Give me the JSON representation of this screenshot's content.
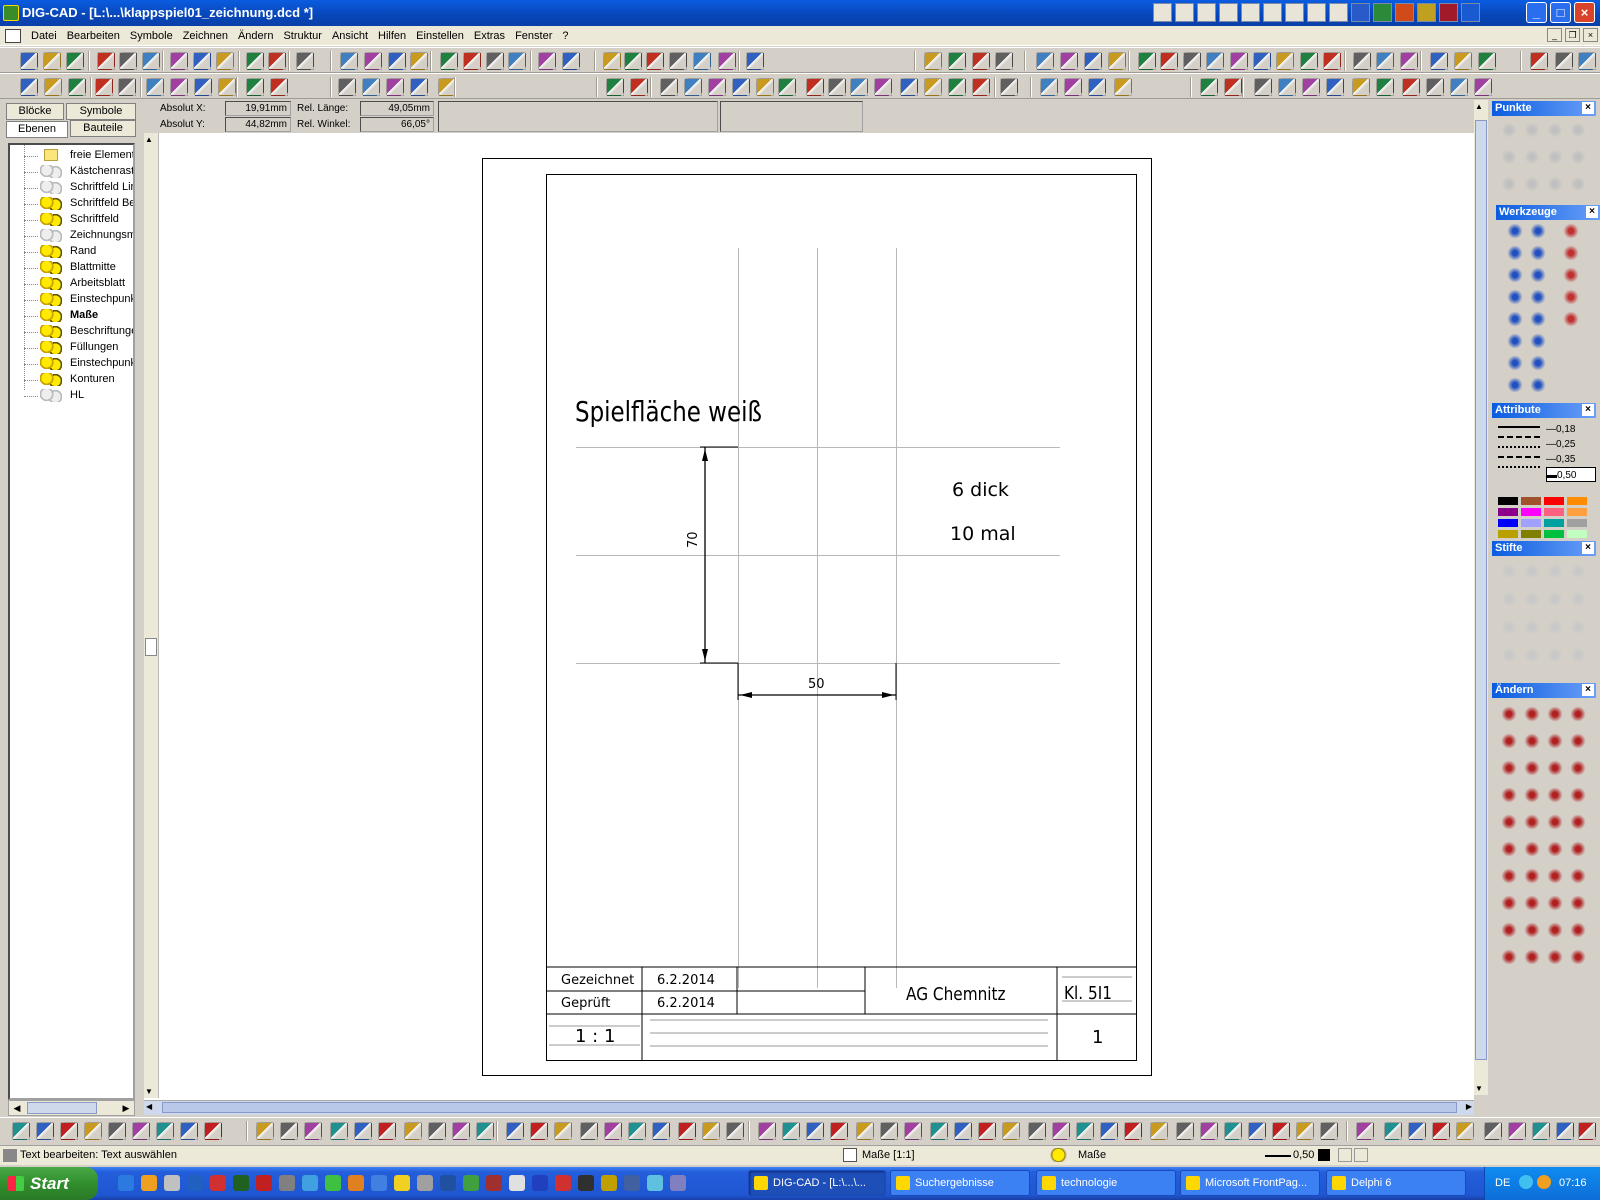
{
  "window": {
    "title": "DIG-CAD - [L:\\...\\klappspiel01_zeichnung.dcd *]",
    "minimize": "_",
    "maximize": "□",
    "close": "×"
  },
  "menu": [
    "Datei",
    "Bearbeiten",
    "Symbole",
    "Zeichnen",
    "Ändern",
    "Struktur",
    "Ansicht",
    "Hilfen",
    "Einstellen",
    "Extras",
    "Fenster",
    "?"
  ],
  "left_panel": {
    "tabs": [
      "Blöcke",
      "Symbole",
      "Ebenen",
      "Bauteile"
    ],
    "active_tab": "Ebenen",
    "layers": [
      {
        "label": "freie Element",
        "icon": "folder-icon",
        "state": "folder",
        "bold": false
      },
      {
        "label": "Kästchenrast",
        "icon": "layer-icon",
        "state": "dim",
        "bold": false
      },
      {
        "label": "Schriftfeld Lir",
        "icon": "layer-icon",
        "state": "dim",
        "bold": false
      },
      {
        "label": "Schriftfeld Be",
        "icon": "layer-icon",
        "state": "lit",
        "bold": false
      },
      {
        "label": "Schriftfeld",
        "icon": "layer-icon",
        "state": "lit",
        "bold": false
      },
      {
        "label": "Zeichnungsmi",
        "icon": "layer-icon",
        "state": "dim",
        "bold": false
      },
      {
        "label": "Rand",
        "icon": "layer-icon",
        "state": "lit",
        "bold": false
      },
      {
        "label": "Blattmitte",
        "icon": "layer-icon",
        "state": "lit",
        "bold": false
      },
      {
        "label": "Arbeitsblatt",
        "icon": "layer-icon",
        "state": "lit",
        "bold": false
      },
      {
        "label": "Einstechpunk",
        "icon": "layer-icon",
        "state": "lit",
        "bold": false
      },
      {
        "label": "Maße",
        "icon": "layer-icon",
        "state": "lit",
        "bold": true
      },
      {
        "label": "Beschriftunger",
        "icon": "layer-icon",
        "state": "lit",
        "bold": false
      },
      {
        "label": "Füllungen",
        "icon": "layer-icon",
        "state": "lit",
        "bold": false
      },
      {
        "label": "Einstechpunk",
        "icon": "layer-icon",
        "state": "lit",
        "bold": false
      },
      {
        "label": "Konturen",
        "icon": "layer-icon",
        "state": "lit",
        "bold": false
      },
      {
        "label": "HL",
        "icon": "layer-icon",
        "state": "dim",
        "bold": false
      }
    ]
  },
  "coords": {
    "abs_x_label": "Absolut X:",
    "abs_x": "19,91mm",
    "abs_y_label": "Absolut Y:",
    "abs_y": "44,82mm",
    "rel_len_label": "Rel. Länge:",
    "rel_len": "49,05mm",
    "rel_angle_label": "Rel. Winkel:",
    "rel_angle": "66,05°"
  },
  "drawing": {
    "title_text": "Spielfläche weiß",
    "note1": "6 dick",
    "note2": "10 mal",
    "dim_vertical": "70",
    "dim_horizontal": "50",
    "titleblock": {
      "drawn_label": "Gezeichnet",
      "drawn_date": "6.2.2014",
      "checked_label": "Geprüft",
      "checked_date": "6.2.2014",
      "org": "AG Chemnitz",
      "class": "Kl. 5I1",
      "scale": "1 : 1",
      "sheet": "1"
    }
  },
  "right_panel": {
    "punkte": "Punkte",
    "werkzeuge": "Werkzeuge",
    "attribute": "Attribute",
    "line_widths": [
      "0,18",
      "0,25",
      "0,35",
      "0,50"
    ],
    "stifte": "Stifte",
    "aendern": "Ändern",
    "palette": [
      "#000000",
      "#a0522d",
      "#ff0000",
      "#ff8c00",
      "#8b008b",
      "#ff00ff",
      "#ff6080",
      "#ffa040",
      "#0000ff",
      "#a0a0ff",
      "#00a0a0",
      "#a0a0a0",
      "#b8a000",
      "#808000",
      "#00c040",
      "#c0ffc0"
    ]
  },
  "statusbar": {
    "hint": "Text bearbeiten: Text auswählen",
    "layer_scale": "Maße [1:1]",
    "layer": "Maße",
    "pen_width": "0,50"
  },
  "taskbar": {
    "start": "Start",
    "tasks": [
      {
        "label": "DIG-CAD - [L:\\...\\...",
        "active": true
      },
      {
        "label": "Suchergebnisse",
        "active": false
      },
      {
        "label": "technologie",
        "active": false
      },
      {
        "label": "Microsoft FrontPag...",
        "active": false
      },
      {
        "label": "Delphi 6",
        "active": false
      }
    ],
    "lang": "DE",
    "clock": "07:16"
  }
}
